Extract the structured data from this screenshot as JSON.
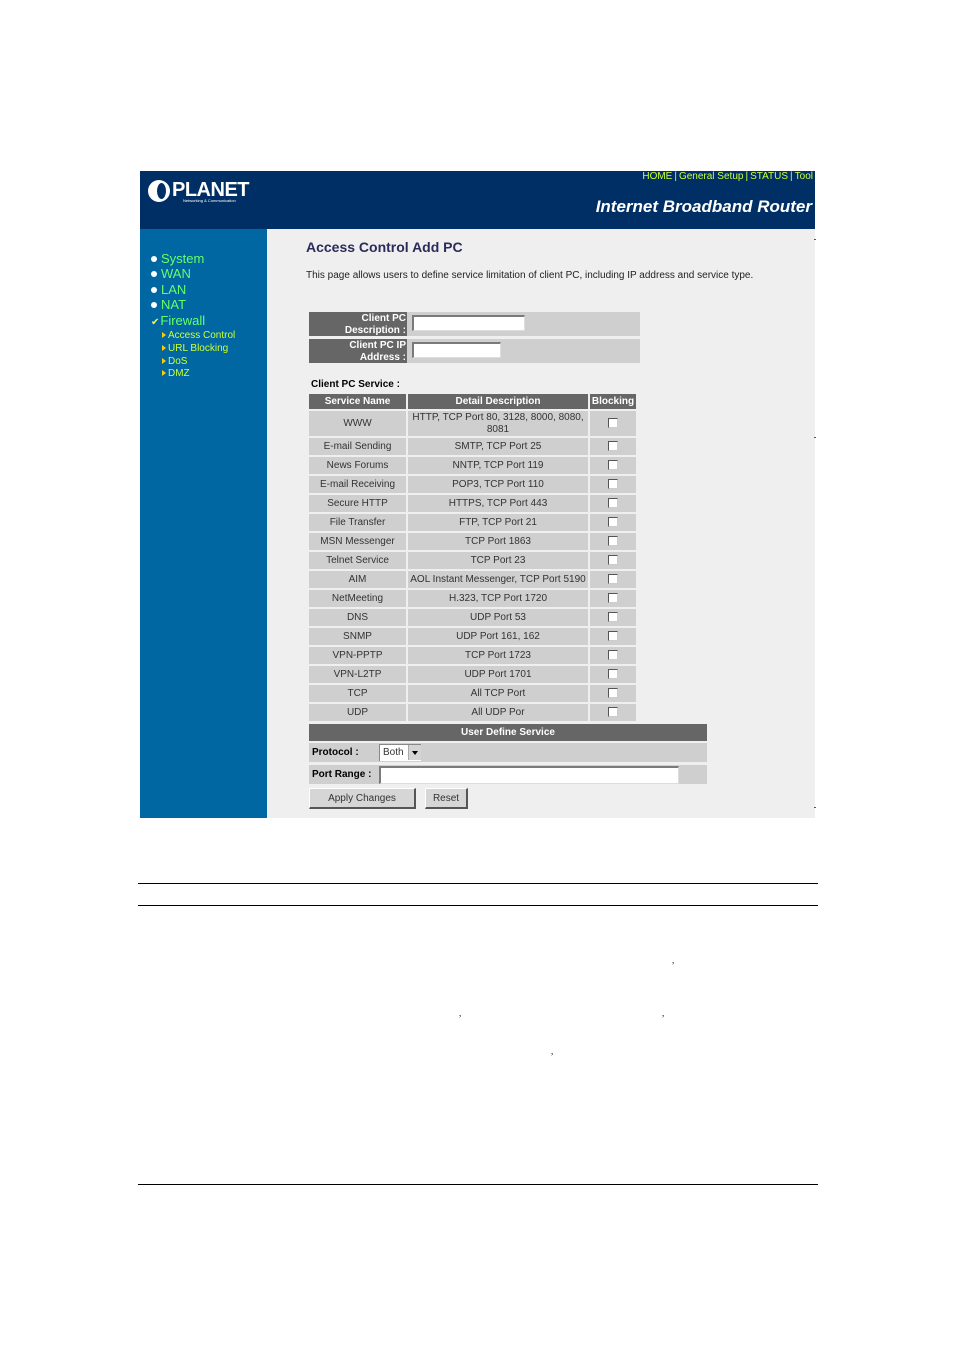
{
  "header": {
    "logo_text": "PLANET",
    "logo_subtitle": "Networking & Communication",
    "top_links": [
      "HOME",
      "General Setup",
      "STATUS",
      "Tool"
    ],
    "product_name": "Internet Broadband Router"
  },
  "sidebar": {
    "items": [
      {
        "label": "System",
        "icon": "bullet-icon"
      },
      {
        "label": "WAN",
        "icon": "bullet-icon"
      },
      {
        "label": "LAN",
        "icon": "bullet-icon"
      },
      {
        "label": "NAT",
        "icon": "bullet-icon"
      },
      {
        "label": "Firewall",
        "icon": "check-icon"
      }
    ],
    "subitems": [
      "Access Control",
      "URL Blocking",
      "DoS",
      "DMZ"
    ]
  },
  "main": {
    "title": "Access Control Add PC",
    "description": "This page allows users to define service limitation of client PC, including IP address and service type.",
    "fields": {
      "description_label_1": "Client PC",
      "description_label_2": "Description :",
      "description_value": "",
      "ip_label_1": "Client PC IP",
      "ip_label_2": "Address :",
      "ip_value": ""
    },
    "service_section_label": "Client PC Service :",
    "table": {
      "headers": [
        "Service Name",
        "Detail Description",
        "Blocking"
      ],
      "rows": [
        {
          "name": "WWW",
          "detail_1": "HTTP, TCP Port 80, 3128, 8000, 8080,",
          "detail_2": "8081",
          "blocked": false
        },
        {
          "name": "E-mail Sending",
          "detail_1": "SMTP, TCP Port 25",
          "blocked": false
        },
        {
          "name": "News Forums",
          "detail_1": "NNTP, TCP Port 119",
          "blocked": false
        },
        {
          "name": "E-mail Receiving",
          "detail_1": "POP3, TCP Port 110",
          "blocked": false
        },
        {
          "name": "Secure HTTP",
          "detail_1": "HTTPS, TCP Port 443",
          "blocked": false
        },
        {
          "name": "File Transfer",
          "detail_1": "FTP, TCP Port 21",
          "blocked": false
        },
        {
          "name": "MSN Messenger",
          "detail_1": "TCP Port 1863",
          "blocked": false
        },
        {
          "name": "Telnet Service",
          "detail_1": "TCP Port 23",
          "blocked": false
        },
        {
          "name": "AIM",
          "detail_1": "AOL Instant Messenger, TCP Port 5190",
          "blocked": false
        },
        {
          "name": "NetMeeting",
          "detail_1": "H.323, TCP Port 1720",
          "blocked": false
        },
        {
          "name": "DNS",
          "detail_1": "UDP Port 53",
          "blocked": false
        },
        {
          "name": "SNMP",
          "detail_1": "UDP Port 161, 162",
          "blocked": false
        },
        {
          "name": "VPN-PPTP",
          "detail_1": "TCP Port 1723",
          "blocked": false
        },
        {
          "name": "VPN-L2TP",
          "detail_1": "UDP Port 1701",
          "blocked": false
        },
        {
          "name": "TCP",
          "detail_1": "All TCP Port",
          "blocked": false
        },
        {
          "name": "UDP",
          "detail_1": "All UDP Por",
          "blocked": false
        }
      ]
    },
    "user_define": {
      "heading": "User Define Service",
      "protocol_label": "Protocol :",
      "protocol_value": "Both",
      "port_range_label": "Port Range :",
      "port_range_value": ""
    },
    "buttons": {
      "apply": "Apply Changes",
      "reset": "Reset"
    }
  },
  "document": {
    "stray_marks": [
      ",",
      ",",
      ",",
      ","
    ]
  }
}
